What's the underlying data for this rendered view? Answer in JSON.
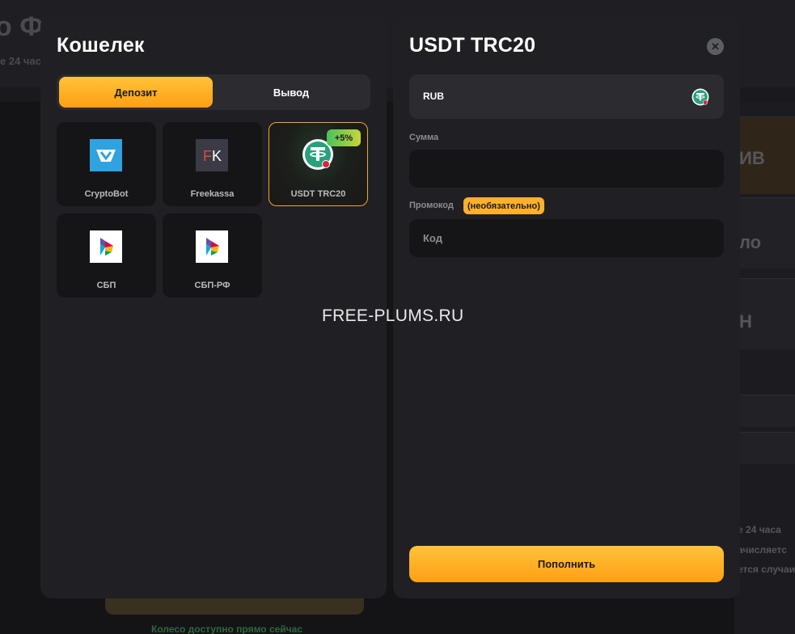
{
  "background": {
    "title": "о Ф",
    "subtitle": "е 24 час",
    "right_cards": [
      "ИВ",
      "ло",
      "Н"
    ],
    "right_small_lines": [
      "е 24 часа",
      "ачисляетс",
      "ется случаи"
    ],
    "bottom_green_text": "Колесо доступно прямо сейчас"
  },
  "wallet": {
    "title": "Кошелек",
    "tabs": {
      "deposit": "Депозит",
      "withdraw": "Вывод"
    },
    "methods": [
      {
        "label": "CryptoBot",
        "icon": "cryptobot-icon"
      },
      {
        "label": "Freekassa",
        "icon": "freekassa-icon",
        "icon_text_f": "F",
        "icon_text_k": "K"
      },
      {
        "label": "USDT TRC20",
        "icon": "tether-icon",
        "bonus": "+5%",
        "selected": true
      },
      {
        "label": "СБП",
        "icon": "sbp-icon"
      },
      {
        "label": "СБП-РФ",
        "icon": "sbp-icon"
      }
    ]
  },
  "deposit_form": {
    "title": "USDT TRC20",
    "close_symbol": "✕",
    "currency": "RUB",
    "amount_label": "Сумма",
    "amount_value": "",
    "promo_label": "Промокод",
    "promo_optional": "(необязательно)",
    "promo_placeholder": "Код",
    "submit_label": "Пополнить"
  },
  "watermark": "FREE-PLUMS.RU",
  "colors": {
    "accent": "#ffa520",
    "panel": "#202024",
    "input_bg": "#151518",
    "tether_green": "#26a17b",
    "cryptobot_blue": "#2fa3e0"
  }
}
